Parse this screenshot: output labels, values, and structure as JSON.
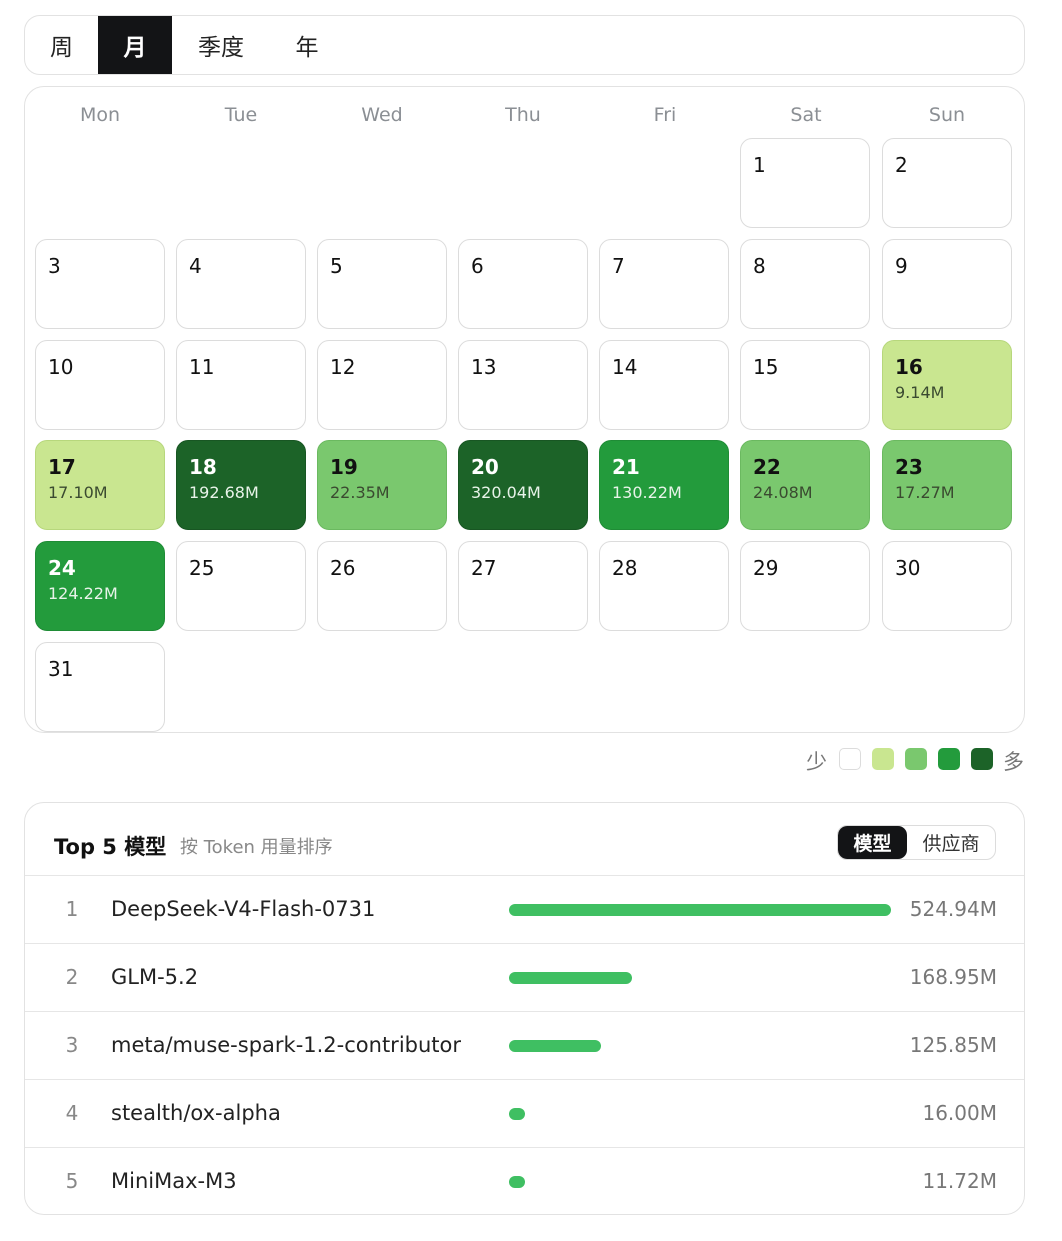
{
  "period_tabs": [
    "周",
    "月",
    "季度",
    "年"
  ],
  "active_tab": "月",
  "calendar": {
    "weekdays": [
      "Mon",
      "Tue",
      "Wed",
      "Thu",
      "Fri",
      "Sat",
      "Sun"
    ],
    "days": [
      {
        "day": "1",
        "value": "",
        "level": 0
      },
      {
        "day": "2",
        "value": "",
        "level": 0
      },
      {
        "day": "3",
        "value": "",
        "level": 0
      },
      {
        "day": "4",
        "value": "",
        "level": 0
      },
      {
        "day": "5",
        "value": "",
        "level": 0
      },
      {
        "day": "6",
        "value": "",
        "level": 0
      },
      {
        "day": "7",
        "value": "",
        "level": 0
      },
      {
        "day": "8",
        "value": "",
        "level": 0
      },
      {
        "day": "9",
        "value": "",
        "level": 0
      },
      {
        "day": "10",
        "value": "",
        "level": 0
      },
      {
        "day": "11",
        "value": "",
        "level": 0
      },
      {
        "day": "12",
        "value": "",
        "level": 0
      },
      {
        "day": "13",
        "value": "",
        "level": 0
      },
      {
        "day": "14",
        "value": "",
        "level": 0
      },
      {
        "day": "15",
        "value": "",
        "level": 0
      },
      {
        "day": "16",
        "value": "9.14M",
        "level": 1
      },
      {
        "day": "17",
        "value": "17.10M",
        "level": 1
      },
      {
        "day": "18",
        "value": "192.68M",
        "level": 4
      },
      {
        "day": "19",
        "value": "22.35M",
        "level": 2
      },
      {
        "day": "20",
        "value": "320.04M",
        "level": 4
      },
      {
        "day": "21",
        "value": "130.22M",
        "level": 3
      },
      {
        "day": "22",
        "value": "24.08M",
        "level": 2
      },
      {
        "day": "23",
        "value": "17.27M",
        "level": 2
      },
      {
        "day": "24",
        "value": "124.22M",
        "level": 3
      },
      {
        "day": "25",
        "value": "",
        "level": 0
      },
      {
        "day": "26",
        "value": "",
        "level": 0
      },
      {
        "day": "27",
        "value": "",
        "level": 0
      },
      {
        "day": "28",
        "value": "",
        "level": 0
      },
      {
        "day": "29",
        "value": "",
        "level": 0
      },
      {
        "day": "30",
        "value": "",
        "level": 0
      },
      {
        "day": "31",
        "value": "",
        "level": 0
      }
    ],
    "first_weekday_index": 5
  },
  "legend": {
    "less": "少",
    "more": "多",
    "colors": [
      "#ffffff",
      "#c9e690",
      "#7ac86e",
      "#239b3c",
      "#1c6328"
    ]
  },
  "top_models": {
    "title": "Top 5 模型",
    "subtitle": "按 Token 用量排序",
    "toggle": [
      "模型",
      "供应商"
    ],
    "active_toggle": "模型",
    "bar_color": "#3fbf62",
    "rows": [
      {
        "rank": "1",
        "name": "DeepSeek-V4-Flash-0731",
        "value": "524.94M",
        "share": 1.0
      },
      {
        "rank": "2",
        "name": "GLM-5.2",
        "value": "168.95M",
        "share": 0.322
      },
      {
        "rank": "3",
        "name": "meta/muse-spark-1.2-contributor",
        "value": "125.85M",
        "share": 0.24
      },
      {
        "rank": "4",
        "name": "stealth/ox-alpha",
        "value": "16.00M",
        "share": 0.04
      },
      {
        "rank": "5",
        "name": "MiniMax-M3",
        "value": "11.72M",
        "share": 0.04
      }
    ]
  }
}
